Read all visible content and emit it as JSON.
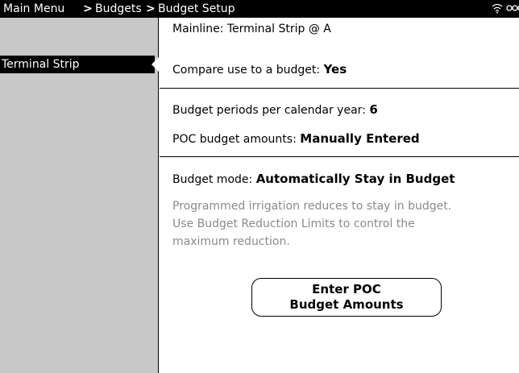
{
  "header": {
    "breadcrumbs": [
      "Main Menu",
      "Budgets",
      "Budget Setup"
    ],
    "separator": ">",
    "status_icons": [
      "wifi-icon",
      "battery-icon"
    ]
  },
  "sidebar": {
    "items": [
      {
        "label": "Terminal Strip",
        "selected": true
      }
    ]
  },
  "main": {
    "mainline_prefix": "Mainline:",
    "mainline_value": "Terminal Strip @ A",
    "compare_label": "Compare use to a budget:",
    "compare_value": "Yes",
    "periods_label": "Budget periods per calendar year:",
    "periods_value": "6",
    "poc_amounts_label": "POC budget amounts:",
    "poc_amounts_value": "Manually Entered",
    "mode_label": "Budget mode:",
    "mode_value": "Automatically Stay in Budget",
    "description_lines": [
      "Programmed irrigation reduces to stay in budget.",
      "Use Budget Reduction Limits to control the",
      "maximum reduction."
    ],
    "button_lines": [
      "Enter POC",
      "Budget Amounts"
    ]
  }
}
